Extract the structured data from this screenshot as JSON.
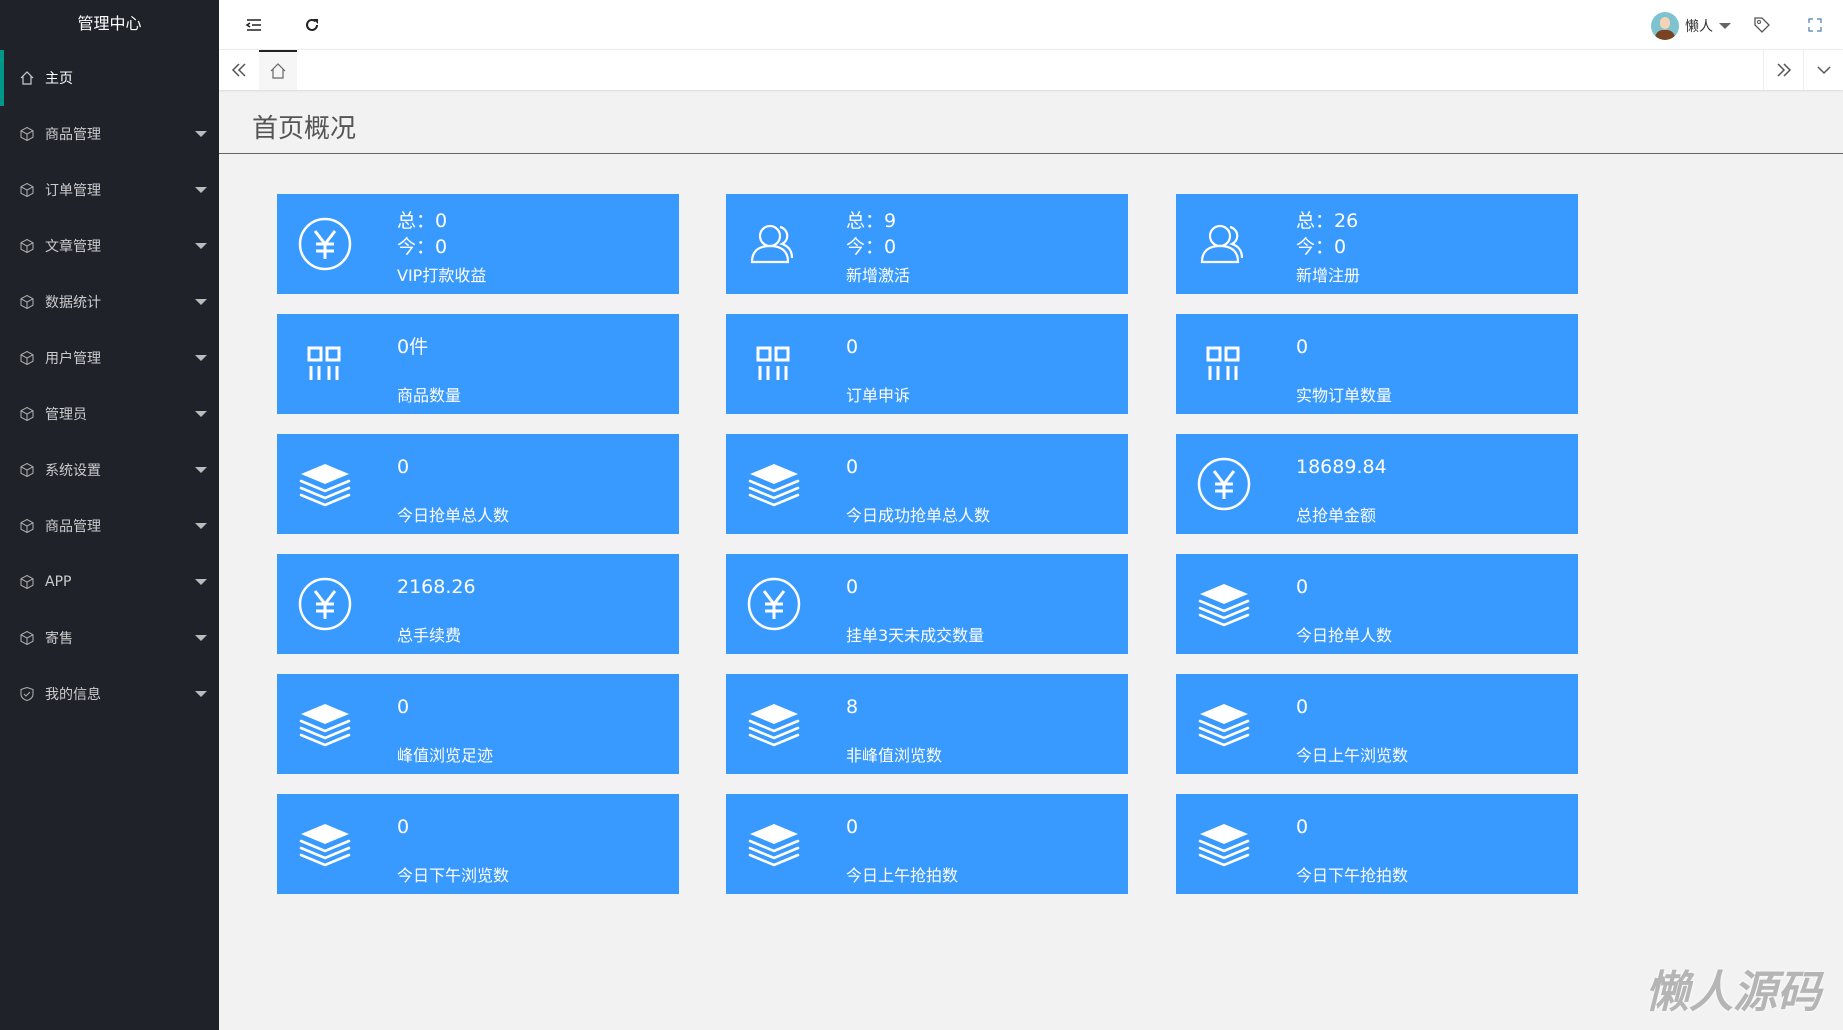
{
  "sidebar": {
    "title": "管理中心",
    "items": [
      {
        "label": "主页",
        "icon": "home-icon",
        "active": true
      },
      {
        "label": "商品管理",
        "icon": "cube-icon"
      },
      {
        "label": "订单管理",
        "icon": "cube-icon"
      },
      {
        "label": "文章管理",
        "icon": "cube-icon"
      },
      {
        "label": "数据统计",
        "icon": "cube-icon"
      },
      {
        "label": "用户管理",
        "icon": "cube-icon"
      },
      {
        "label": "管理员",
        "icon": "cube-icon"
      },
      {
        "label": "系统设置",
        "icon": "cube-icon"
      },
      {
        "label": "商品管理",
        "icon": "cube-icon"
      },
      {
        "label": "APP",
        "icon": "cube-icon"
      },
      {
        "label": "寄售",
        "icon": "cube-icon"
      },
      {
        "label": "我的信息",
        "icon": "shield-icon"
      }
    ]
  },
  "header": {
    "user": "懒人"
  },
  "page": {
    "title": "首页概况"
  },
  "cards": [
    {
      "icon": "yen",
      "total": "总：0",
      "today": "今：0",
      "label": "VIP打款收益"
    },
    {
      "icon": "users",
      "total": "总：9",
      "today": "今：0",
      "label": "新增激活"
    },
    {
      "icon": "users",
      "total": "总：26",
      "today": "今：0",
      "label": "新增注册"
    },
    {
      "icon": "grid",
      "value": "0件",
      "label": "商品数量"
    },
    {
      "icon": "grid",
      "value": "0",
      "label": "订单申诉"
    },
    {
      "icon": "grid",
      "value": "0",
      "label": "实物订单数量"
    },
    {
      "icon": "layers",
      "value": "0",
      "label": "今日抢单总人数"
    },
    {
      "icon": "layers",
      "value": "0",
      "label": "今日成功抢单总人数"
    },
    {
      "icon": "yen",
      "value": "18689.84",
      "label": "总抢单金额"
    },
    {
      "icon": "yen",
      "value": "2168.26",
      "label": "总手续费"
    },
    {
      "icon": "yen",
      "value": "0",
      "label": "挂单3天未成交数量"
    },
    {
      "icon": "layers",
      "value": "0",
      "label": "今日抢单人数"
    },
    {
      "icon": "layers",
      "value": "0",
      "label": "峰值浏览足迹"
    },
    {
      "icon": "layers",
      "value": "8",
      "label": "非峰值浏览数"
    },
    {
      "icon": "layers",
      "value": "0",
      "label": "今日上午浏览数"
    },
    {
      "icon": "layers",
      "value": "0",
      "label": "今日下午浏览数"
    },
    {
      "icon": "layers",
      "value": "0",
      "label": "今日上午抢拍数"
    },
    {
      "icon": "layers",
      "value": "0",
      "label": "今日下午抢拍数"
    }
  ],
  "watermark": "懒人源码",
  "colors": {
    "sidebar": "#20222a",
    "accent": "#009688",
    "card": "#3899fe"
  }
}
